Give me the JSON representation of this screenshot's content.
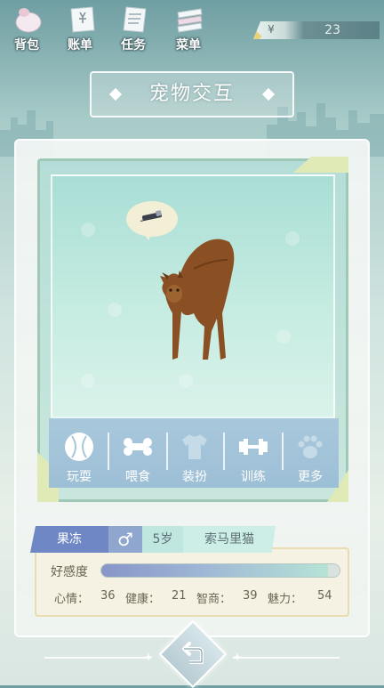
{
  "topbar": {
    "buttons": [
      {
        "label": "背包",
        "icon": "bag-icon"
      },
      {
        "label": "账单",
        "icon": "bill-icon"
      },
      {
        "label": "任务",
        "icon": "task-list-icon"
      },
      {
        "label": "菜单",
        "icon": "menu-icon"
      }
    ],
    "currency_symbol": "¥",
    "money": "23"
  },
  "title": "宠物交互",
  "pet_scene": {
    "bubble_icon": "laser-pointer-icon",
    "pet_icon": "cat"
  },
  "actions": [
    {
      "label": "玩耍",
      "icon": "ball-icon"
    },
    {
      "label": "喂食",
      "icon": "bone-icon"
    },
    {
      "label": "装扮",
      "icon": "shirt-icon"
    },
    {
      "label": "训练",
      "icon": "dumbbell-icon"
    },
    {
      "label": "更多",
      "icon": "paw-icon"
    }
  ],
  "pet": {
    "name": "果冻",
    "gender_symbol": "♂",
    "age": "5岁",
    "breed": "索马里猫",
    "affection_label": "好感度",
    "affection_fraction": 0.95,
    "stats": [
      {
        "label": "心情：",
        "value": "36"
      },
      {
        "label": "健康：",
        "value": "21"
      },
      {
        "label": "智商：",
        "value": "39"
      },
      {
        "label": "魅力：",
        "value": "54"
      }
    ]
  },
  "colors": {
    "name_tag": "#6f87c4",
    "gender_tag": "#8fa7cf",
    "age_tag": "#bfe6df",
    "breed_tag": "#cdeee7",
    "action_bar": "#a5c4d9"
  },
  "bottom": {
    "back_icon": "return-arrow-icon"
  }
}
